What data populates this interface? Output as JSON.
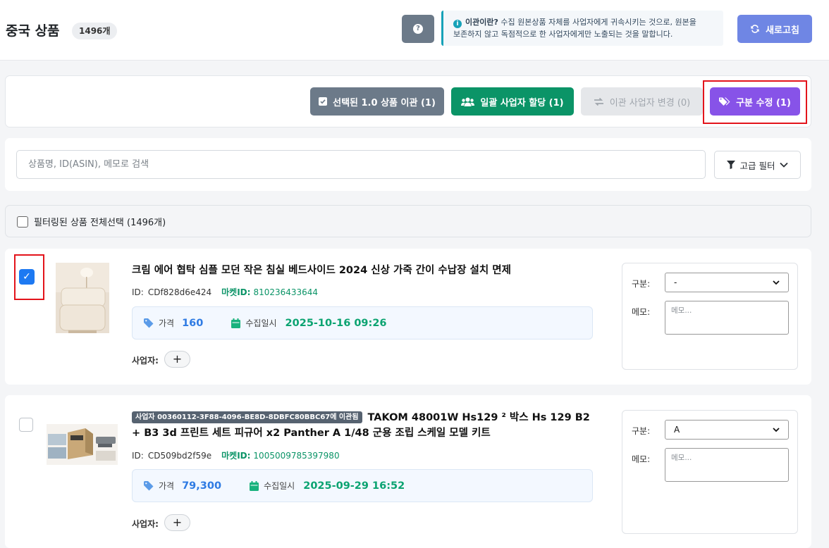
{
  "header": {
    "title": "중국 상품",
    "count_badge": "1496개",
    "help_icon": "question-circle-icon",
    "info_title": "이관이란?",
    "info_text_line1": "수집 원본상품 자체를 사업자에게 귀속시키는 것으로, 원본을",
    "info_text_line2": "보존하지 않고 독점적으로 한 사업자에게만 노출되는 것을 말합니다.",
    "refresh_label": "새로고침"
  },
  "actions": {
    "transfer_label": "선택된 1.0 상품 이관 (1)",
    "assign_label": "일괄 사업자 할당 (1)",
    "change_label": "이관 사업자 변경 (0)",
    "category_label": "구분 수정 (1)"
  },
  "search": {
    "placeholder": "상품명, ID(ASIN), 메모로 검색",
    "filter_label": "고급 필터"
  },
  "select_all": {
    "label": "필터링된 상품 전체선택 (1496개)"
  },
  "products": [
    {
      "checked": true,
      "title": "크림 에어 협탁 심플 모던 작은 침실 베드사이드 2024 신상 가죽 간이 수납장 설치 면제",
      "id_label": "ID:",
      "id": "CDf828d6e424",
      "market_label": "마켓ID:",
      "market_id": "810236433644",
      "price_label": "가격",
      "price": "160",
      "date_label": "수집일시",
      "date": "2025-10-16 09:26",
      "biz_label": "사업자:",
      "category_label": "구분:",
      "category_value": "-",
      "memo_label": "메모:",
      "memo_placeholder": "메모..."
    },
    {
      "checked": false,
      "badge": "사업자 00360112-3F88-4096-BE8D-8DBFC80BBC67에 이관됨",
      "title": "TAKOM 48001W Hs129 ² 박스 Hs 129 B2 + B3 3d 프린트 세트 피규어 x2 Panther A 1/48 군용 조립 스케일 모델 키트",
      "id_label": "ID:",
      "id": "CD509bd2f59e",
      "market_label": "마켓ID:",
      "market_id": "1005009785397980",
      "price_label": "가격",
      "price": "79,300",
      "date_label": "수집일시",
      "date": "2025-09-29 16:52",
      "biz_label": "사업자:",
      "category_label": "구분:",
      "category_value": "A",
      "memo_label": "메모:",
      "memo_placeholder": "메모..."
    }
  ],
  "colors": {
    "primary_blue": "#6f86e4",
    "green": "#0b9467",
    "purple": "#8753e8",
    "slate": "#6c7a89",
    "highlight_red": "#e3141b"
  }
}
